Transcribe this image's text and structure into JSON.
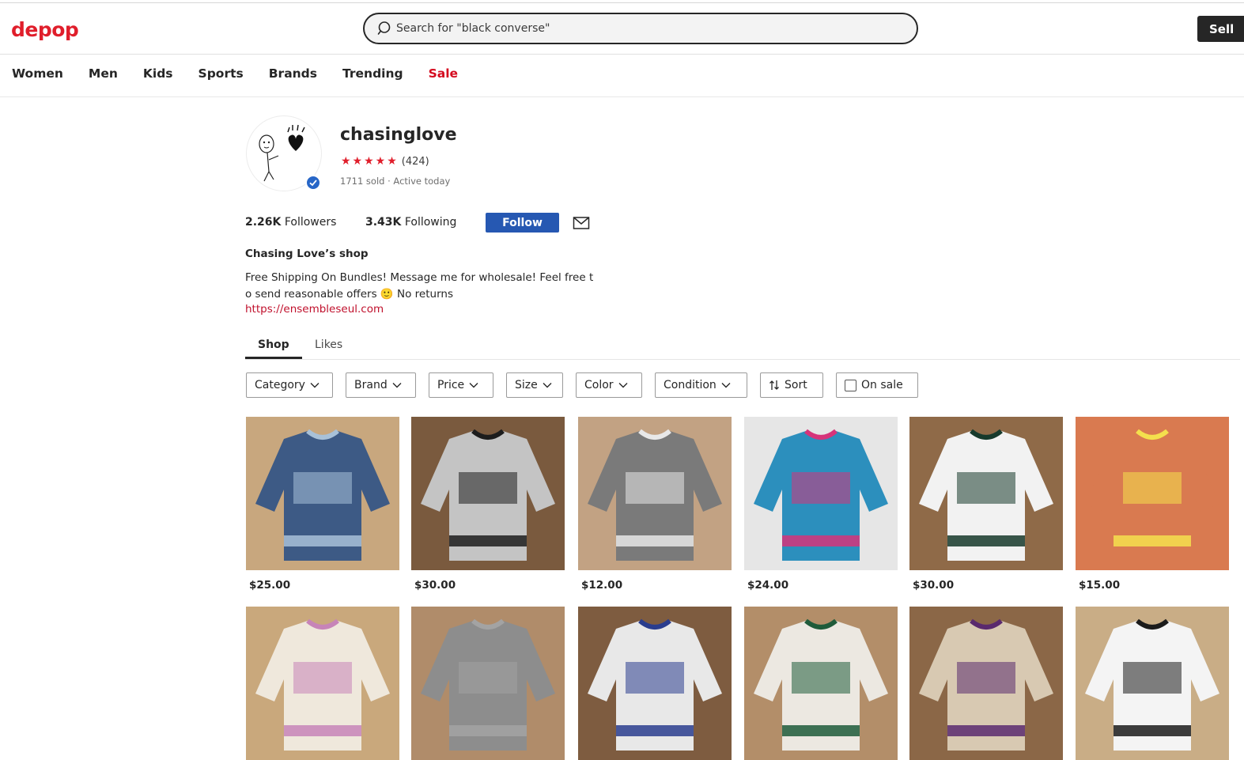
{
  "header": {
    "logo": "depop",
    "search_placeholder": "Search for \"black converse\"",
    "sell_label": "Sell"
  },
  "nav": [
    "Women",
    "Men",
    "Kids",
    "Sports",
    "Brands",
    "Trending",
    "Sale"
  ],
  "profile": {
    "username": "chasinglove",
    "stars": "★★★★★",
    "review_count": "(424)",
    "meta": "1711 sold · Active today",
    "followers_count": "2.26K",
    "followers_label": "Followers",
    "following_count": "3.43K",
    "following_label": "Following",
    "follow_label": "Follow",
    "shop_title": "Chasing Love’s shop",
    "bio_line1": "Free Shipping On Bundles! Message me for wholesale! Feel free t",
    "bio_line2": "o send reasonable offers 🙂 No returns",
    "link": "https://ensembleseul.com"
  },
  "tabs": [
    "Shop",
    "Likes"
  ],
  "filters": [
    "Category",
    "Brand",
    "Price",
    "Size",
    "Color",
    "Condition",
    "Sort",
    "On sale"
  ],
  "products": [
    {
      "price": "$25.00",
      "bg": "#c8a77e",
      "main": "#3d5a85",
      "accent": "#a8c1d8"
    },
    {
      "price": "$30.00",
      "bg": "#7a5a3e",
      "main": "#c4c4c4",
      "accent": "#1d1d1d"
    },
    {
      "price": "$12.00",
      "bg": "#c2a283",
      "main": "#7a7a7a",
      "accent": "#e8e8e8"
    },
    {
      "price": "$24.00",
      "bg": "#e6e6e6",
      "main": "#2c8fbd",
      "accent": "#d6347a"
    },
    {
      "price": "$30.00",
      "bg": "#8f6a48",
      "main": "#f2f2f2",
      "accent": "#173a2c"
    },
    {
      "price": "$15.00",
      "bg": "#d97a50",
      "main": "#d97a50",
      "accent": "#f4e04d"
    },
    {
      "price": "",
      "bg": "#c9a87c",
      "main": "#efe8dc",
      "accent": "#c784b8"
    },
    {
      "price": "",
      "bg": "#b08c6a",
      "main": "#8d8d8d",
      "accent": "#a3a3a3"
    },
    {
      "price": "",
      "bg": "#7e5c40",
      "main": "#e8e8e8",
      "accent": "#2a3d8e"
    },
    {
      "price": "",
      "bg": "#b38e69",
      "main": "#ece8e1",
      "accent": "#1f5b3a"
    },
    {
      "price": "",
      "bg": "#8b6747",
      "main": "#d8c9b2",
      "accent": "#5a2a6e"
    },
    {
      "price": "",
      "bg": "#c9ad86",
      "main": "#f4f4f4",
      "accent": "#1b1b1b"
    }
  ]
}
